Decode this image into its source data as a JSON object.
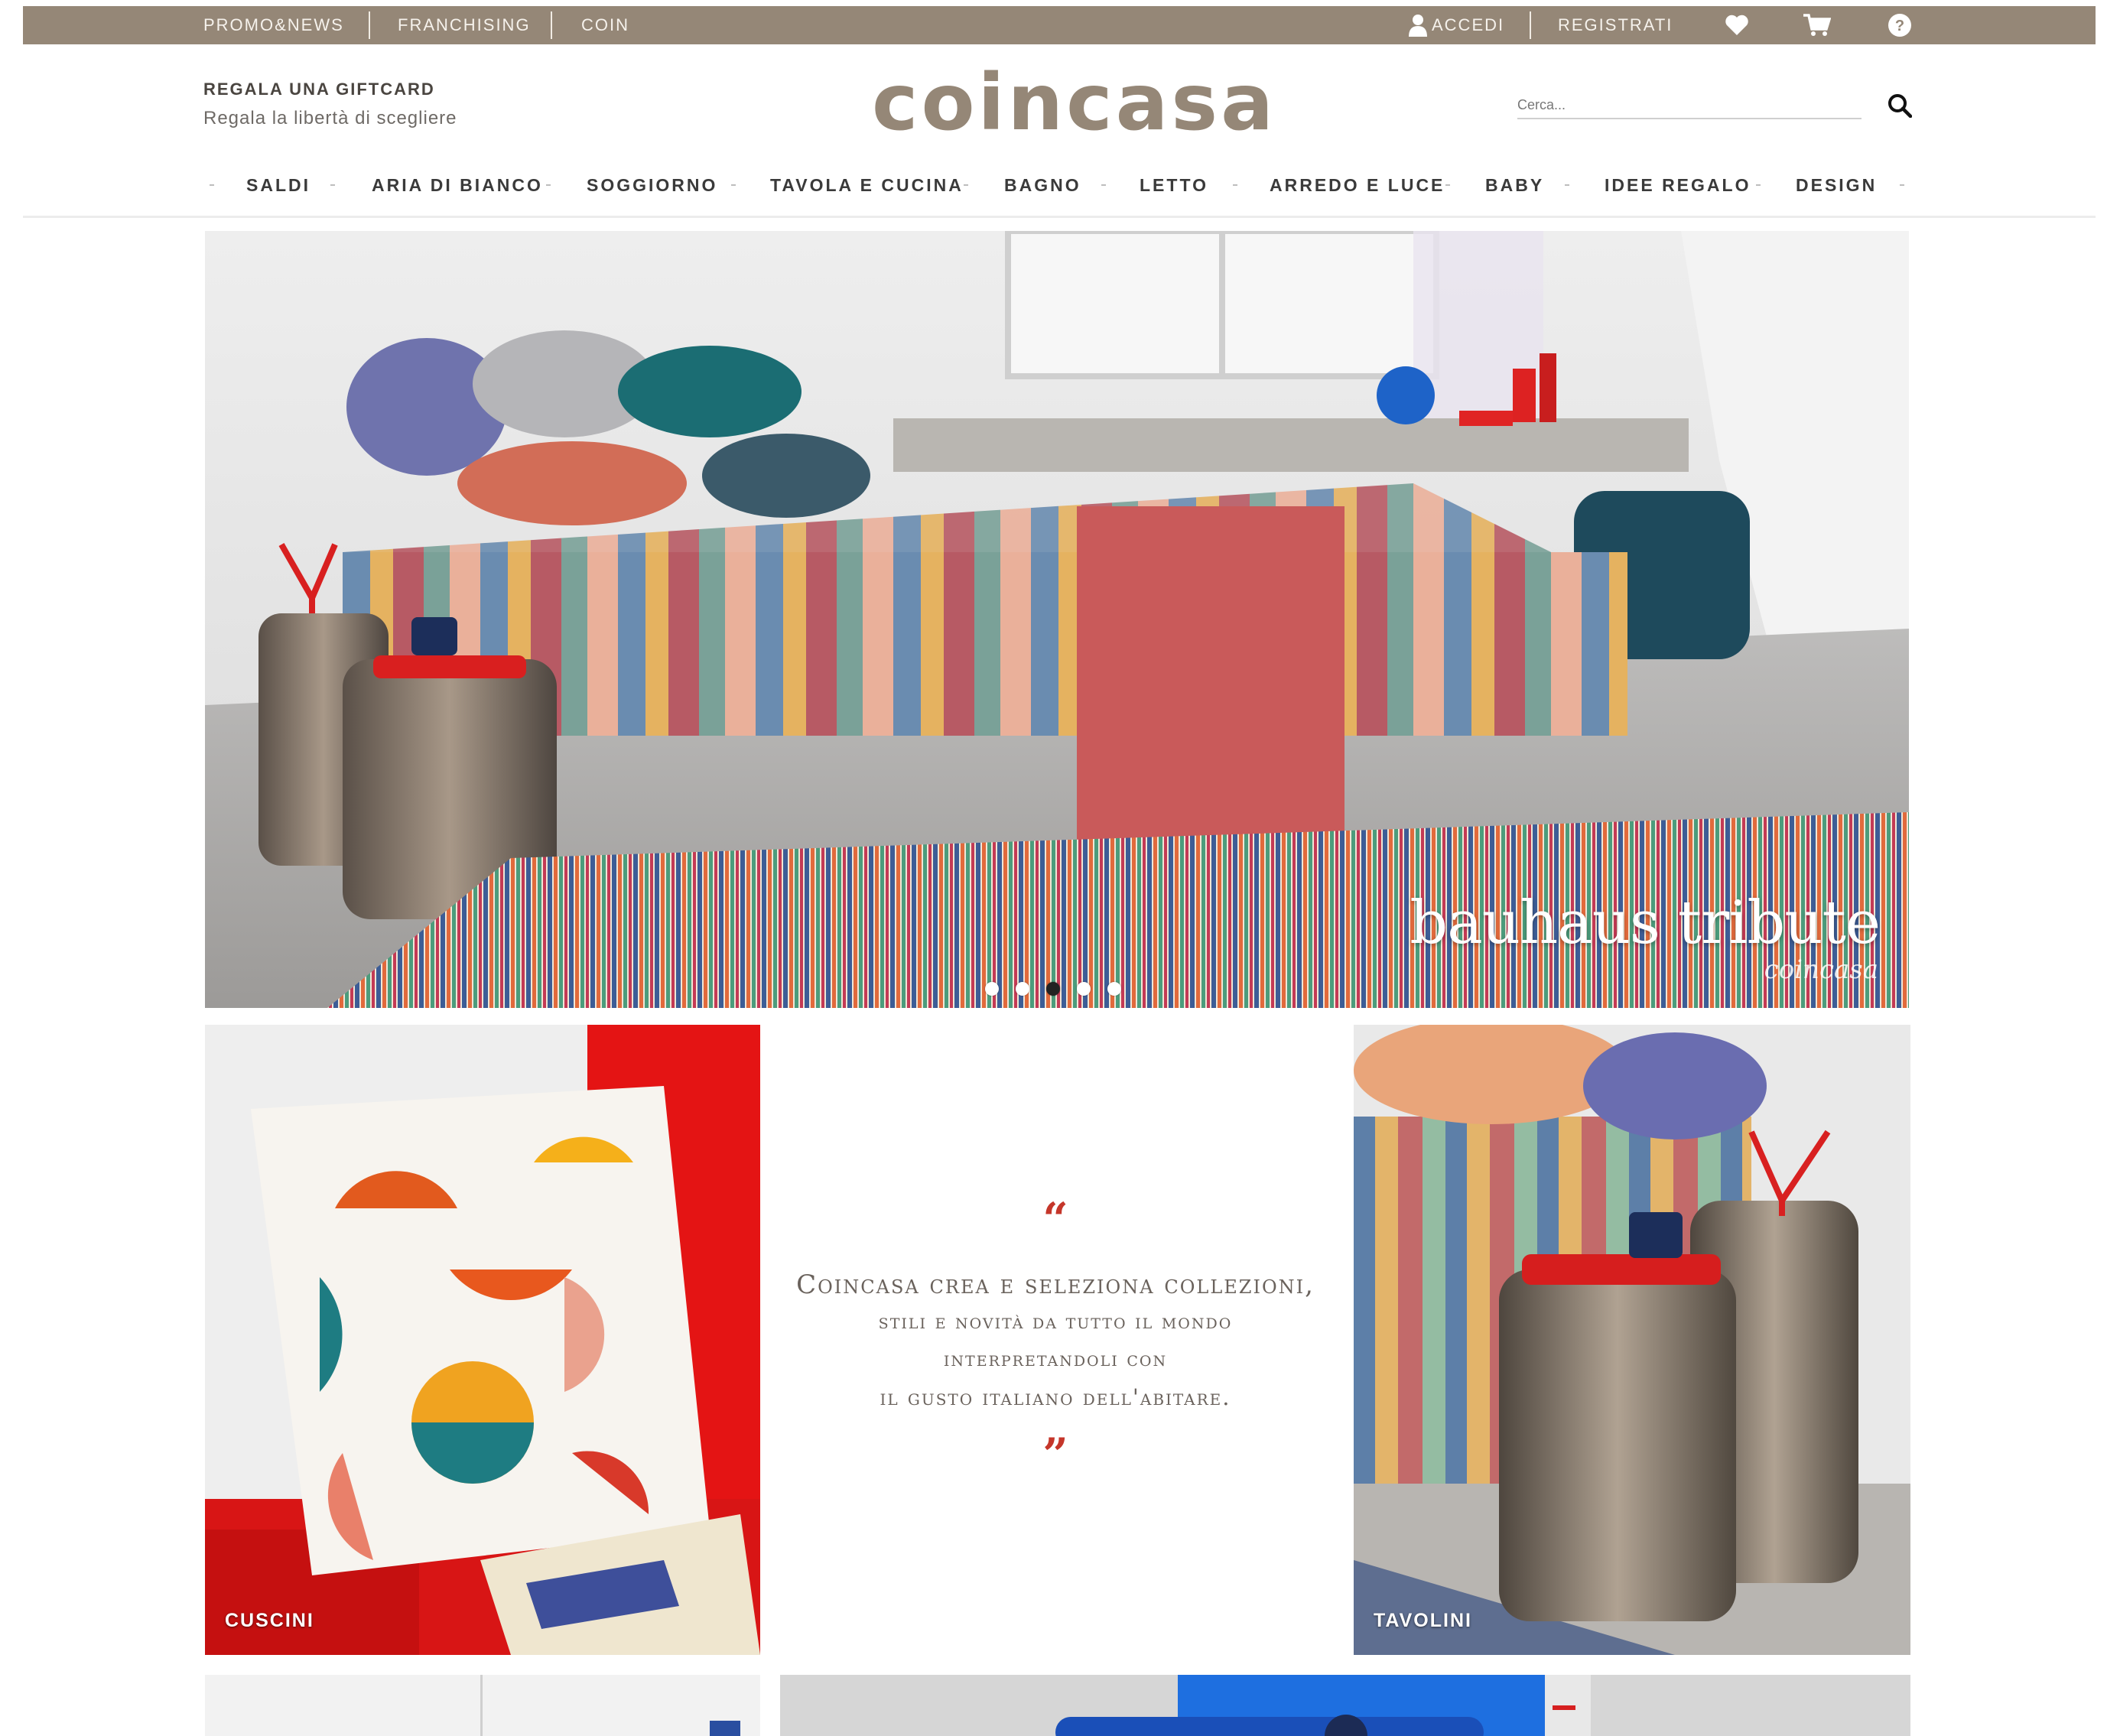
{
  "topbar": {
    "links": [
      "PROMO&NEWS",
      "FRANCHISING",
      "COIN"
    ],
    "login": "ACCEDI",
    "register": "REGISTRATI",
    "icons": [
      "user-icon",
      "heart-icon",
      "cart-icon",
      "help-icon"
    ]
  },
  "header": {
    "gift_title": "REGALA UNA GIFTCARD",
    "gift_subtitle": "Regala la libertà di scegliere",
    "logo": "coincasa",
    "search_placeholder": "Cerca..."
  },
  "nav": {
    "items": [
      "SALDI",
      "ARIA DI BIANCO",
      "SOGGIORNO",
      "TAVOLA E CUCINA",
      "BAGNO",
      "LETTO",
      "ARREDO E LUCE",
      "BABY",
      "IDEE REGALO",
      "DESIGN"
    ]
  },
  "hero": {
    "caption": "bauhaus tribute",
    "brand": "coincasa",
    "slides": 5,
    "active_slide": 3
  },
  "tiles": {
    "left_label": "CUSCINI",
    "right_label": "TAVOLINI"
  },
  "quote": {
    "open": "“",
    "close": "”",
    "lines": [
      "Coincasa crea e seleziona collezioni,",
      "stili e novità da tutto il mondo",
      "interpretandoli con",
      "il gusto italiano dell'abitare."
    ]
  },
  "colors": {
    "brand": "#958777",
    "accent_red": "#c5362a"
  }
}
